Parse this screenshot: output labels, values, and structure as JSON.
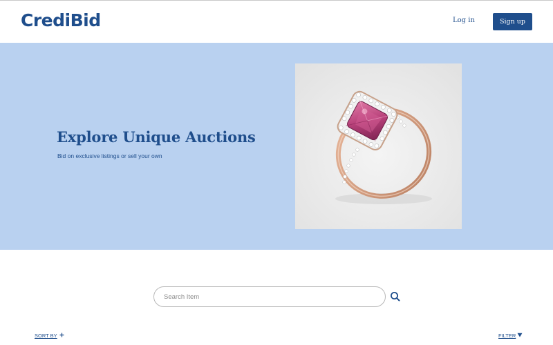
{
  "header": {
    "logo": "CrediBid",
    "login_label": "Log in",
    "signup_label": "Sign up"
  },
  "hero": {
    "title": "Explore Unique Auctions",
    "subtitle": "Bid on exclusive listings or sell your own",
    "image_icon": "ring-image"
  },
  "search": {
    "placeholder": "Search Item",
    "value": "",
    "icon": "search-icon"
  },
  "controls": {
    "sort_label": "SORT BY",
    "sort_icon": "plus-icon",
    "filter_label": "FILTER",
    "filter_icon": "triangle-down-icon"
  },
  "colors": {
    "brand": "#1f4e8c",
    "hero_bg": "#b9d1f0"
  }
}
